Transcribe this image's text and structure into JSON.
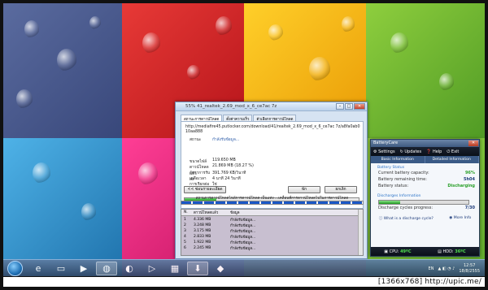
{
  "download_window": {
    "title": "55% 41_realtek_2.69_mod_x_6_ce7ac 7z",
    "tabs": [
      "สถานะการดาวน์โหลด",
      "ตั้งค่าความเร็ว",
      "ตัวเลือกการดาวน์โหลด"
    ],
    "url": "http://mediafire45.putlocker.com/download/41/realtek_2.69_mod_x_6_ce7ac 7z/a8fa0ab010aa888",
    "status_label": "สถานะ",
    "status_value": "กำลังรับข้อมูล...",
    "rows": [
      {
        "label": "ขนาดไฟล์",
        "value": "119.650 MB"
      },
      {
        "label": "ดาวน์โหลดแล้ว",
        "value": "21.869 MB (18.27 %)"
      },
      {
        "label": "อัตราการรับส่ง",
        "value": "391.769 KB/วินาที"
      },
      {
        "label": "เหลือเวลา",
        "value": "4 นาที 24 วินาที"
      },
      {
        "label": "การเรียกต่อได้",
        "value": "ใช่"
      }
    ],
    "progress_percent": 18.27,
    "show_details_button": "<< ซ่อนรายละเอียด",
    "pause_button": "พัก",
    "cancel_button": "ยกเลิก",
    "segments_label": "สถานการดาวน์โหลดไฟล์การดาวน์โหลด เป็นแท่ง ...เคลื่อนที่การดาวน์โหลดไปในการดาวน์โหลด",
    "table_headers": [
      "N.",
      "ดาวน์โหลดแล้ว",
      "ข้อมูล"
    ],
    "table_rows": [
      [
        "1",
        "4.336 MB",
        "กำลังรับข้อมูล..."
      ],
      [
        "2",
        "3.248 MB",
        "กำลังรับข้อมูล..."
      ],
      [
        "3",
        "3.175 MB",
        "กำลังรับข้อมูล..."
      ],
      [
        "4",
        "2.833 MB",
        "กำลังรับข้อมูล..."
      ],
      [
        "5",
        "1.922 MB",
        "กำลังรับข้อมูล..."
      ],
      [
        "6",
        "2.245 MB",
        "กำลังรับข้อมูล..."
      ]
    ]
  },
  "batterycare": {
    "title": "BatteryCare",
    "menu": [
      "Settings",
      "Updates",
      "Help",
      "Exit"
    ],
    "tabs": [
      "Basic Information",
      "Detailed Information"
    ],
    "section_status": "Battery Status",
    "current_capacity_label": "Current battery capacity:",
    "current_capacity_value": "96%",
    "remaining_label": "Battery remaining time:",
    "remaining_value": "5h04",
    "status_label": "Battery status:",
    "status_value": "Discharging",
    "section_discharges": "Discharges Information",
    "cycles_label": "Discharge cycles progress:",
    "cycles_value": "7/30",
    "cycles_fraction": 0.233,
    "link_discharge": "What is a discharge cycle?",
    "link_more": "More Info",
    "cpu_label": "CPU:",
    "cpu_value": "49ºC",
    "hdd_label": "HDD:",
    "hdd_value": "36ºC"
  },
  "taskbar": {
    "lang": "EN",
    "time": "12:57",
    "date": "18/8/2555"
  },
  "watermark": "[1366x768] http://upic.me/",
  "colors": {
    "wall_blue": "#4a5a8c",
    "wall_red": "#d6262b",
    "wall_yellow": "#f2b80f",
    "wall_green": "#6fb433",
    "wall_cyan": "#2c8fd0",
    "wall_pink": "#e61e7c",
    "wall_orange": "#f07b14"
  }
}
